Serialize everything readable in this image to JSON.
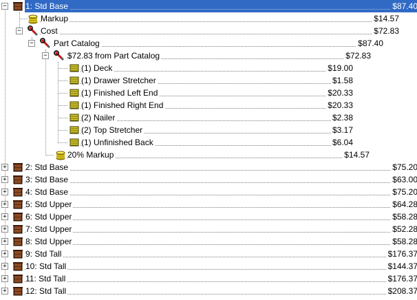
{
  "tree": {
    "items": [
      {
        "label": "1: Std Base",
        "price": "$87.40",
        "icon": "cabinet-icon",
        "toggle": "−",
        "selected": true
      },
      {
        "label": "Markup",
        "price": "$14.57",
        "icon": "coins-icon"
      },
      {
        "label": "Cost",
        "price": "$72.83",
        "icon": "wrench-icon",
        "toggle": "−"
      },
      {
        "label": "Part Catalog",
        "price": "$87.40",
        "icon": "wrench-icon",
        "toggle": "−"
      },
      {
        "label": "$72.83 from Part Catalog",
        "price": "$72.83",
        "icon": "wrench-icon",
        "toggle": "−"
      },
      {
        "label": "(1) Deck",
        "price": "$19.00",
        "icon": "panel-icon"
      },
      {
        "label": "(1) Drawer Stretcher",
        "price": "$1.58",
        "icon": "panel-icon"
      },
      {
        "label": "(1) Finished Left End",
        "price": "$20.33",
        "icon": "panel-icon"
      },
      {
        "label": "(1) Finished Right End",
        "price": "$20.33",
        "icon": "panel-icon"
      },
      {
        "label": "(2) Nailer",
        "price": "$2.38",
        "icon": "panel-icon"
      },
      {
        "label": "(2) Top Stretcher",
        "price": "$3.17",
        "icon": "panel-icon"
      },
      {
        "label": "(1) Unfinished Back",
        "price": "$6.04",
        "icon": "panel-icon"
      },
      {
        "label": "20% Markup",
        "price": "$14.57",
        "icon": "coins-icon"
      },
      {
        "label": "2: Std Base",
        "price": "$75.20",
        "icon": "cabinet-icon",
        "toggle": "+"
      },
      {
        "label": "3: Std Base",
        "price": "$63.00",
        "icon": "cabinet-icon",
        "toggle": "+"
      },
      {
        "label": "4: Std Base",
        "price": "$75.20",
        "icon": "cabinet-icon",
        "toggle": "+"
      },
      {
        "label": "5: Std Upper",
        "price": "$64.28",
        "icon": "cabinet-icon",
        "toggle": "+"
      },
      {
        "label": "6: Std Upper",
        "price": "$58.28",
        "icon": "cabinet-icon",
        "toggle": "+"
      },
      {
        "label": "7: Std Upper",
        "price": "$52.28",
        "icon": "cabinet-icon",
        "toggle": "+"
      },
      {
        "label": "8: Std Upper",
        "price": "$58.28",
        "icon": "cabinet-icon",
        "toggle": "+"
      },
      {
        "label": "9: Std Tall",
        "price": "$176.37",
        "icon": "cabinet-icon",
        "toggle": "+"
      },
      {
        "label": "10: Std Tall",
        "price": "$144.37",
        "icon": "cabinet-icon",
        "toggle": "+"
      },
      {
        "label": "11: Std Tall",
        "price": "$176.37",
        "icon": "cabinet-icon",
        "toggle": "+"
      },
      {
        "label": "12: Std Tall",
        "price": "$208.37",
        "icon": "cabinet-icon",
        "toggle": "+"
      }
    ]
  },
  "colors": {
    "selection": "#316ac5",
    "connector": "#8a8a8a"
  }
}
